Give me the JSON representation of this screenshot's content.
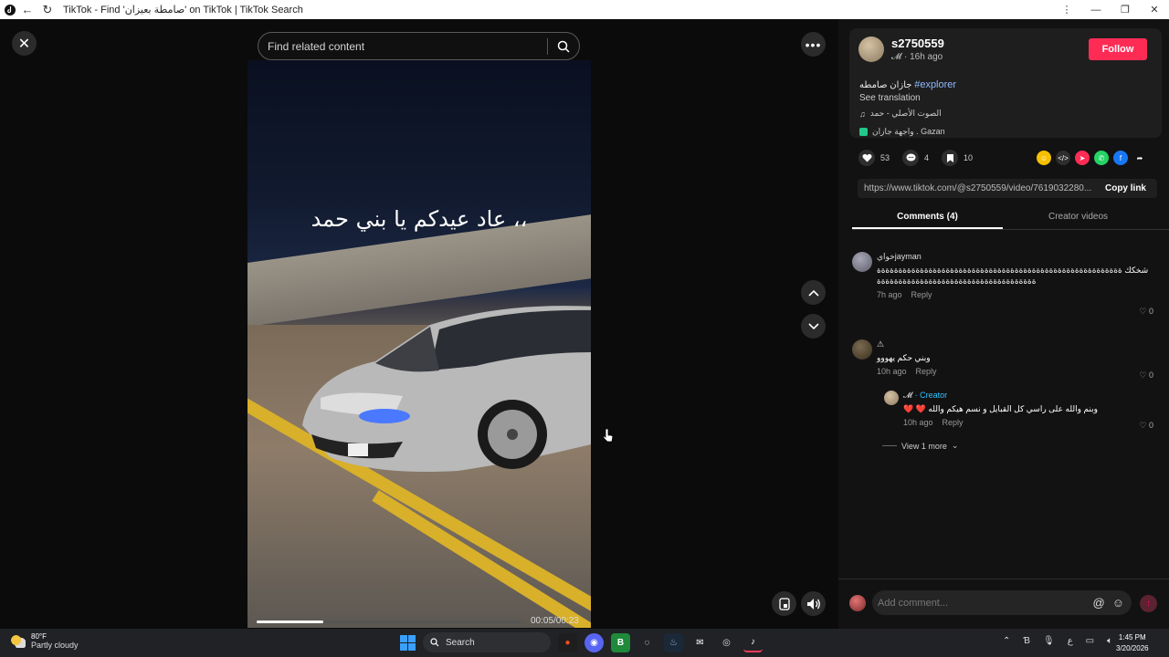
{
  "window": {
    "title": "TikTok - Find 'صامطة بعيزان' on TikTok | TikTok Search"
  },
  "search": {
    "placeholder": "Find related content"
  },
  "video": {
    "caption": "عاد عيدكم يا بني حمد ،،",
    "time": "00:05/00:23",
    "progress_fraction": 0.25
  },
  "post": {
    "username": "s2750559",
    "display_name": "𝓜",
    "age": "16h ago",
    "follow_label": "Follow",
    "description_text": "جازان صامطه",
    "hashtag": "#explorer",
    "see_translation": "See translation",
    "music": "الصوت الأصلي - حمد",
    "location": "واجهة جازان . Gazan",
    "likes": "53",
    "comments": "4",
    "saves": "10",
    "link": "https://www.tiktok.com/@s2750559/video/7619032280...",
    "copy_label": "Copy link"
  },
  "tabs": [
    "Comments (4)",
    "Creator videos"
  ],
  "comments": [
    {
      "name": "خوايjayman",
      "text": "شخكك ةةةةةةةةةةةةةةةةةةةةةةةةةةةةةةةةةةةةةةةةةةةةةةةةةةةةةةةةةةةةةةةةةةةةةةةةةةةةةةةةةةةةةةةةةةةةةة",
      "time": "7h ago",
      "reply": "Reply",
      "likes": "0"
    },
    {
      "name": "⚠",
      "text": "وبني حكم يهووو",
      "time": "10h ago",
      "reply": "Reply",
      "likes": "0"
    },
    {
      "name": "𝓜",
      "badge": "· Creator",
      "text": "❤️ ❤️ وبنم والله على راسي كل القبايل و نسم هيكم والله",
      "time": "10h ago",
      "reply": "Reply",
      "likes": "0"
    }
  ],
  "view_more": "View 1 more",
  "comment_input": {
    "placeholder": "Add comment..."
  },
  "taskbar": {
    "temp": "80°F",
    "condition": "Partly cloudy",
    "search_label": "Search",
    "time": "1:45 PM",
    "date": "3/20/2026"
  },
  "colors": {
    "accent": "#fe2c55",
    "panel": "#121212",
    "creator": "#2ec4ff"
  }
}
